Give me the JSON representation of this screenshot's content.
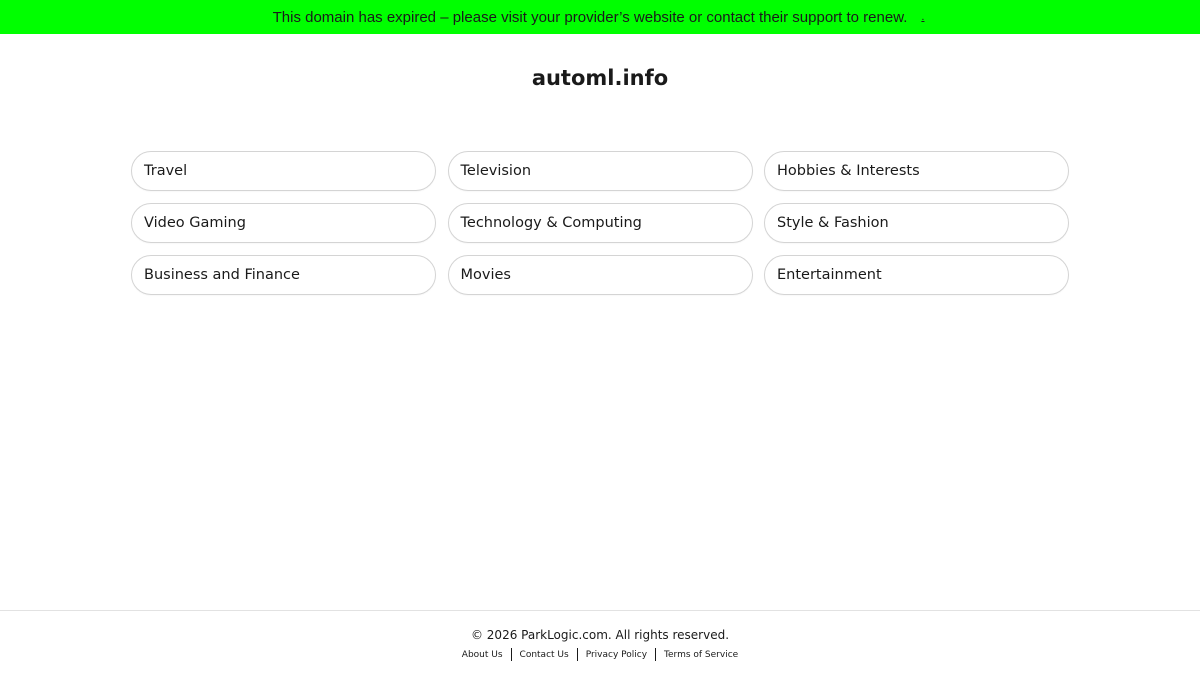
{
  "banner": {
    "message": "This domain has expired – please visit your provider’s website or contact their support to renew.",
    "link_label": "."
  },
  "site": {
    "title": "automl.info"
  },
  "categories": [
    "Travel",
    "Television",
    "Hobbies & Interests",
    "Video Gaming",
    "Technology & Computing",
    "Style & Fashion",
    "Business and Finance",
    "Movies",
    "Entertainment"
  ],
  "footer": {
    "copyright": "© 2026 ParkLogic.com. All rights reserved.",
    "links": [
      "About Us",
      "Contact Us",
      "Privacy Policy",
      "Terms of Service"
    ]
  },
  "colors": {
    "banner_background": "#00ff00",
    "pill_border": "#d4d4d4",
    "text": "#1a1a1a"
  }
}
